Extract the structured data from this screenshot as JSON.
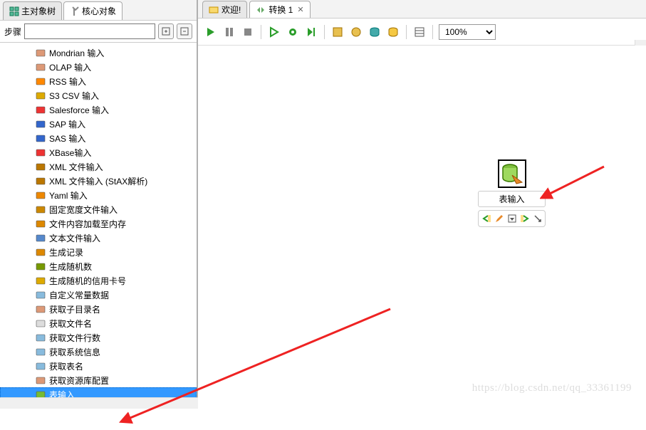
{
  "leftTabs": {
    "main": "主对象树",
    "core": "核心对象"
  },
  "search": {
    "label": "步骤",
    "expandTitle": "展开",
    "collapseTitle": "收起"
  },
  "tree": [
    "Mondrian 输入",
    "OLAP 输入",
    "RSS 输入",
    "S3 CSV 输入",
    "Salesforce 输入",
    "SAP 输入",
    "SAS 输入",
    "XBase输入",
    "XML 文件输入",
    "XML 文件输入 (StAX解析)",
    "Yaml 输入",
    "固定宽度文件输入",
    "文件内容加载至内存",
    "文本文件输入",
    "生成记录",
    "生成随机数",
    "生成随机的信用卡号",
    "自定义常量数据",
    "获取子目录名",
    "获取文件名",
    "获取文件行数",
    "获取系统信息",
    "获取表名",
    "获取资源库配置",
    "表输入"
  ],
  "treeSelectedIndex": 24,
  "editorTabs": {
    "welcome": "欢迎!",
    "transform": "转换 1"
  },
  "zoom": "100%",
  "stepNode": {
    "label": "表输入"
  },
  "watermark": "https://blog.csdn.net/qq_33361199"
}
